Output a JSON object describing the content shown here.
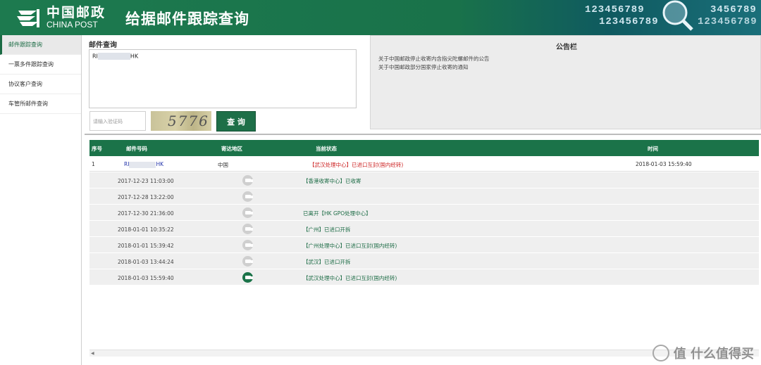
{
  "header": {
    "logo_cn": "中国邮政",
    "logo_en": "CHINA POST",
    "title": "给据邮件跟踪查询",
    "deco_numbers": [
      "123456789",
      "3456789",
      "123456789",
      "123456789"
    ]
  },
  "sidebar": {
    "items": [
      {
        "label": "邮件跟踪查询",
        "active": true
      },
      {
        "label": "一票多件跟踪查询",
        "active": false
      },
      {
        "label": "协议客户查询",
        "active": false
      },
      {
        "label": "车管所邮件查询",
        "active": false
      }
    ]
  },
  "query": {
    "label": "邮件查询",
    "value_prefix": "RI",
    "value_suffix": "HK",
    "captcha_placeholder": "请输入验证码",
    "captcha_text": "5776",
    "submit_label": "查 询"
  },
  "notice": {
    "title": "公告栏",
    "items": [
      "关于中国邮政停止收寄内含指尖陀螺邮件的公告",
      "关于中国邮政部分国家停止收寄的通知"
    ]
  },
  "table": {
    "headers": [
      "序号",
      "邮件号码",
      "寄达地区",
      "当前状态",
      "时间"
    ],
    "main": {
      "index": "1",
      "number_prefix": "RI",
      "number_suffix": "HK",
      "destination": "中国",
      "status": "【武汉处理中心】已进口互封(国内经转)",
      "time": "2018-01-03 15:59:40"
    },
    "history": [
      {
        "time": "2017-12-23 11:03:00",
        "status": "【香港收寄中心】已收寄"
      },
      {
        "time": "2017-12-28 13:22:00",
        "status": ""
      },
      {
        "time": "2017-12-30 21:36:00",
        "status": "已离开【HK GPO处理中心】"
      },
      {
        "time": "2018-01-01 10:35:22",
        "status": "【广州】已进口开拆"
      },
      {
        "time": "2018-01-01 15:39:42",
        "status": "【广州处理中心】已进口互封(国内经转)"
      },
      {
        "time": "2018-01-03 13:44:24",
        "status": "【武汉】已进口开拆"
      },
      {
        "time": "2018-01-03 15:59:40",
        "status": "【武汉处理中心】已进口互封(国内经转)"
      }
    ]
  },
  "watermark": "值 什么值得买",
  "colors": {
    "brand_green": "#1b7349",
    "status_red": "#cc2222",
    "link_blue": "#2233aa"
  }
}
